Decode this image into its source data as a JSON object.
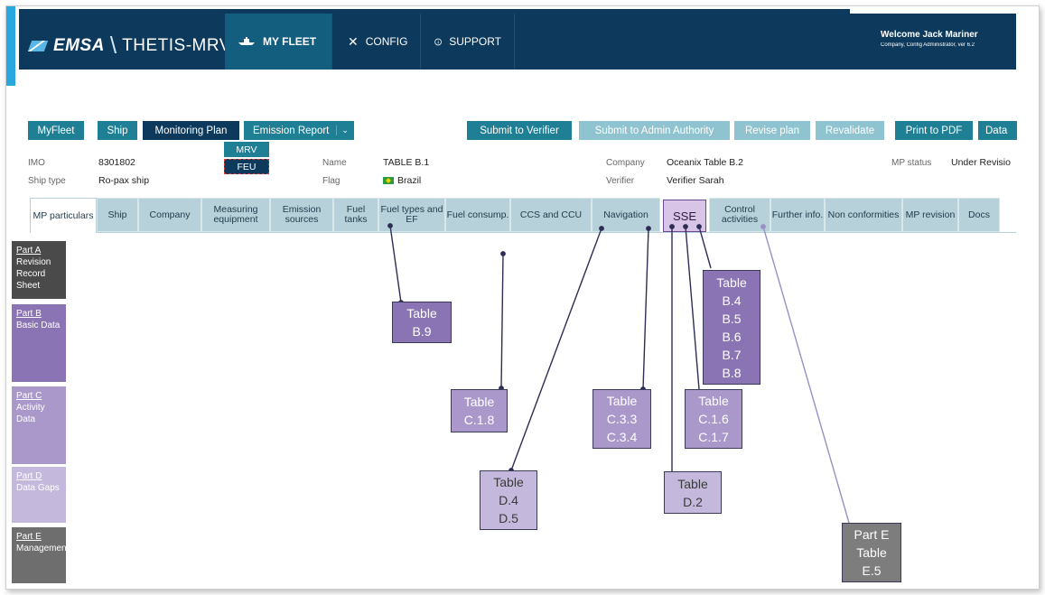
{
  "header": {
    "logo_emsa": "EMSA",
    "logo_thetis": "THETIS-MRV",
    "nav": [
      {
        "label": "MY FLEET",
        "icon": "ship-icon"
      },
      {
        "label": "CONFIG",
        "icon": "tools-icon"
      },
      {
        "label": "SUPPORT",
        "icon": "info-icon"
      }
    ],
    "welcome": "Welcome Jack Mariner",
    "welcome_sub": "Company, Config Administrator, ver 6.2"
  },
  "toolbar": {
    "myfleet": "MyFleet",
    "ship": "Ship",
    "monitoring_plan": "Monitoring Plan",
    "emission_report": "Emission Report",
    "submit_verifier": "Submit to Verifier",
    "submit_admin": "Submit to Admin Authority",
    "revise_plan": "Revise plan",
    "revalidate": "Revalidate",
    "print_pdf": "Print to PDF",
    "data": "Data"
  },
  "dropdown": {
    "mrv": "MRV",
    "feu": "FEU"
  },
  "info": {
    "imo_label": "IMO",
    "imo": "8301802",
    "shiptype_label": "Ship type",
    "shiptype": "Ro-pax ship",
    "name_label": "Name",
    "name": "TABLE B.1",
    "flag_label": "Flag",
    "flag": "Brazil",
    "company_label": "Company",
    "company": "Oceanix Table B.2",
    "verifier_label": "Verifier",
    "verifier": "Verifier Sarah",
    "mpstatus_label": "MP status",
    "mpstatus": "Under Revisio"
  },
  "tabs": {
    "mp_particulars": "MP particulars",
    "ship": "Ship",
    "company": "Company",
    "measuring": "Measuring equipment",
    "emission": "Emission sources",
    "fuel_tanks": "Fuel tanks",
    "fuel_types": "Fuel types and EF",
    "fuel_consump": "Fuel consump.",
    "ccs": "CCS and CCU",
    "navigation": "Navigation",
    "sse": "SSE",
    "control": "Control activities",
    "further": "Further info.",
    "nonconf": "Non conformities",
    "mprev": "MP revision",
    "docs": "Docs"
  },
  "parts": [
    {
      "name": "Part A",
      "desc": "Revision Record Sheet",
      "color": "#4a4a4a"
    },
    {
      "name": "Part B",
      "desc": "Basic Data",
      "color": "#8b74b4"
    },
    {
      "name": "Part C",
      "desc": "Activity Data",
      "color": "#a998c9"
    },
    {
      "name": "Part D",
      "desc": "Data Gaps",
      "color": "#c4b9dc"
    },
    {
      "name": "Part E",
      "desc": "Management",
      "color": "#6e6e6e"
    }
  ],
  "callouts": {
    "b9": [
      "Table",
      "B.9"
    ],
    "b4": [
      "Table",
      "B.4",
      "B.5",
      "B.6",
      "B.7",
      "B.8"
    ],
    "c18": [
      "Table",
      "C.1.8"
    ],
    "c33": [
      "Table",
      "C.3.3",
      "C.3.4"
    ],
    "c16": [
      "Table",
      "C.1.6",
      "C.1.7"
    ],
    "d4": [
      "Table",
      "D.4",
      "D.5"
    ],
    "d2": [
      "Table",
      "D.2"
    ],
    "e5": [
      "Part E",
      "Table",
      "E.5"
    ]
  }
}
